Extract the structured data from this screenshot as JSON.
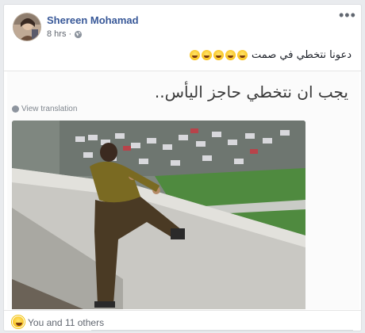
{
  "post": {
    "author": "Shereen Mohamad",
    "time": "8 hrs",
    "separator": "·",
    "text": "دعونا نتخطي في صمت",
    "emoji_count": 5
  },
  "shared": {
    "caption": "يجب ان نتخطي حاجز اليأس..",
    "view_translation": "View translation"
  },
  "reactions": {
    "summary": "You and 11 others",
    "icon": "haha-icon"
  },
  "colors": {
    "author_link": "#385898",
    "meta": "#616770",
    "background": "#e9ebee"
  }
}
